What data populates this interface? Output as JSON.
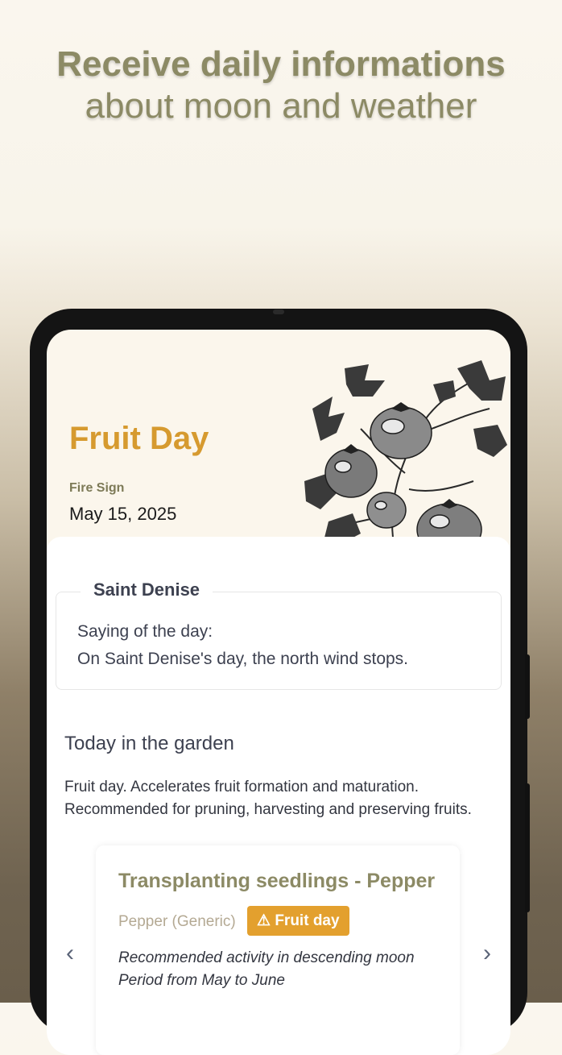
{
  "headline": {
    "line1": "Receive daily informations",
    "line2": "about moon and weather"
  },
  "day": {
    "title": "Fruit Day",
    "sign": "Fire Sign",
    "date": "May 15, 2025"
  },
  "saint": {
    "name": "Saint Denise",
    "saying_label": "Saying of the day:",
    "saying_text": "On Saint Denise's day, the north wind stops."
  },
  "garden": {
    "title": "Today in the garden",
    "description": "Fruit day. Accelerates fruit formation and maturation. Recommended for pruning, harvesting and preserving fruits."
  },
  "activity": {
    "title": "Transplanting seedlings - Pepper",
    "variety": "Pepper (Generic)",
    "badge_icon": "⚠",
    "badge_text": "Fruit day",
    "note_line1": "Recommended activity in descending moon",
    "note_line2": "Period from May to June"
  },
  "icons": {
    "prev": "chevron-left-icon",
    "next": "chevron-right-icon",
    "warning": "warning-icon"
  },
  "colors": {
    "accent": "#d69a2f",
    "olive": "#8c8a65",
    "badge": "#e3a02e"
  }
}
